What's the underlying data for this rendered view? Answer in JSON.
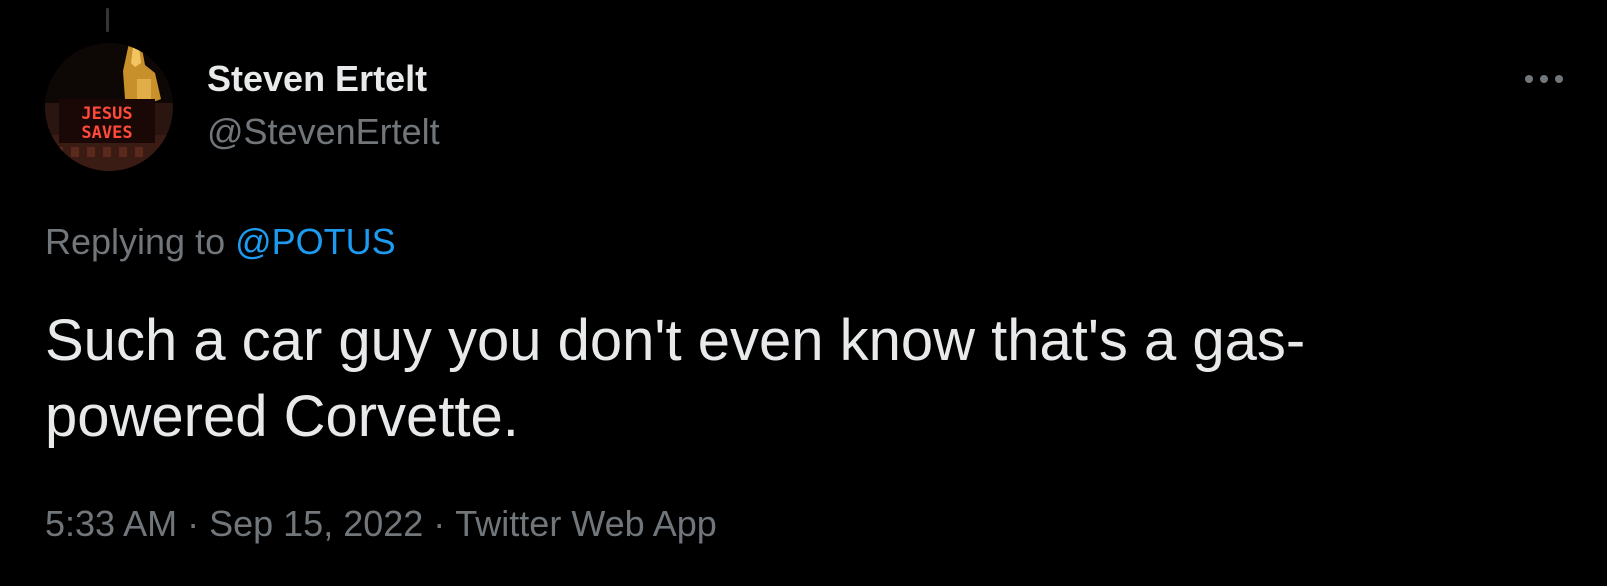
{
  "user": {
    "display_name": "Steven Ertelt",
    "handle": "@StevenErtelt",
    "avatar": {
      "icon": "jesus-saves-neon-sign-avatar",
      "sign_line_1": "JESUS",
      "sign_line_2": "SAVES"
    }
  },
  "menu": {
    "icon": "more-horizontal-icon"
  },
  "reply": {
    "prefix": "Replying to",
    "mention": "@POTUS"
  },
  "tweet": {
    "text": "Such a car guy you don't even know that's a gas-powered Corvette."
  },
  "meta": {
    "time": "5:33 AM",
    "separator": "·",
    "date": "Sep 15, 2022",
    "source": "Twitter Web App"
  },
  "colors": {
    "background": "#000000",
    "primary_text": "#e7e9ea",
    "secondary_text": "#71767b",
    "accent": "#1d9bf0"
  }
}
